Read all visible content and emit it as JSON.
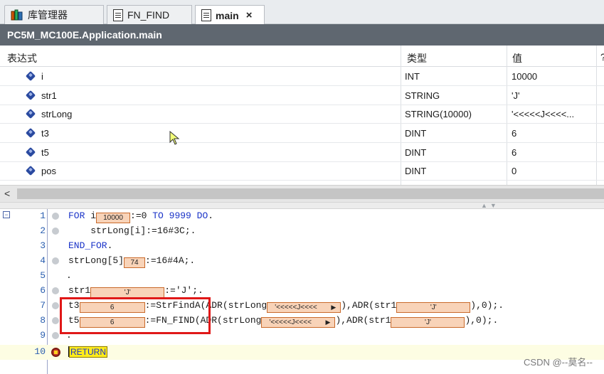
{
  "tabs": [
    {
      "label": "库管理器",
      "icon": "library-icon"
    },
    {
      "label": "FN_FIND",
      "icon": "document-icon"
    },
    {
      "label": "main",
      "icon": "document-icon",
      "active": true,
      "close": "×"
    }
  ],
  "title": "PC5M_MC100E.Application.main",
  "watch": {
    "headers": {
      "expr": "表达式",
      "type": "类型",
      "value": "值",
      "extra": "?"
    },
    "rows": [
      {
        "name": "i",
        "type": "INT",
        "value": "10000"
      },
      {
        "name": "str1",
        "type": "STRING",
        "value": "'J'"
      },
      {
        "name": "strLong",
        "type": "STRING(10000)",
        "value": "'<<<<<J<<<<..."
      },
      {
        "name": "t3",
        "type": "DINT",
        "value": "6"
      },
      {
        "name": "t5",
        "type": "DINT",
        "value": "6"
      },
      {
        "name": "pos",
        "type": "DINT",
        "value": "0"
      }
    ]
  },
  "scroll": {
    "left_arrow": "<"
  },
  "code": {
    "line_numbers": [
      "1",
      "2",
      "3",
      "4",
      "5",
      "6",
      "7",
      "8",
      "9",
      "10"
    ],
    "l1": {
      "kw_for": "FOR",
      "var": " i",
      "mon": "10000",
      "assign": ":=0 ",
      "kw_to": "TO",
      "end": " 9999 ",
      "kw_do": "DO",
      "dot": "."
    },
    "l2": {
      "text": "    strLong[i]:=16#3C;."
    },
    "l3": {
      "kw": "END_FOR",
      "dot": "."
    },
    "l4": {
      "pre": "strLong[5]",
      "mon": "74",
      "post": ":=16#4A;."
    },
    "l5": {
      "text": "."
    },
    "l6": {
      "pre": "str1",
      "mon": "'J'",
      "post": ":='J';."
    },
    "l7": {
      "pre": "t3",
      "mon": "6",
      "mid": ":=StrFindA(ADR(strLong",
      "mon_arr": "'<<<<<J<<<<",
      "mid2": "),ADR(str1",
      "mon2": "'J'",
      "post": "),0);."
    },
    "l8": {
      "pre": "t5",
      "mon": "6",
      "mid": ":=FN_FIND(ADR(strLong",
      "mon_arr": "'<<<<<J<<<<",
      "mid2": "),ADR(str1",
      "mon2": "'J'",
      "post": "),0);."
    },
    "l9": {
      "text": "."
    },
    "l10": {
      "ret": "RETURN"
    }
  },
  "watermark": "CSDN @--莫名--"
}
